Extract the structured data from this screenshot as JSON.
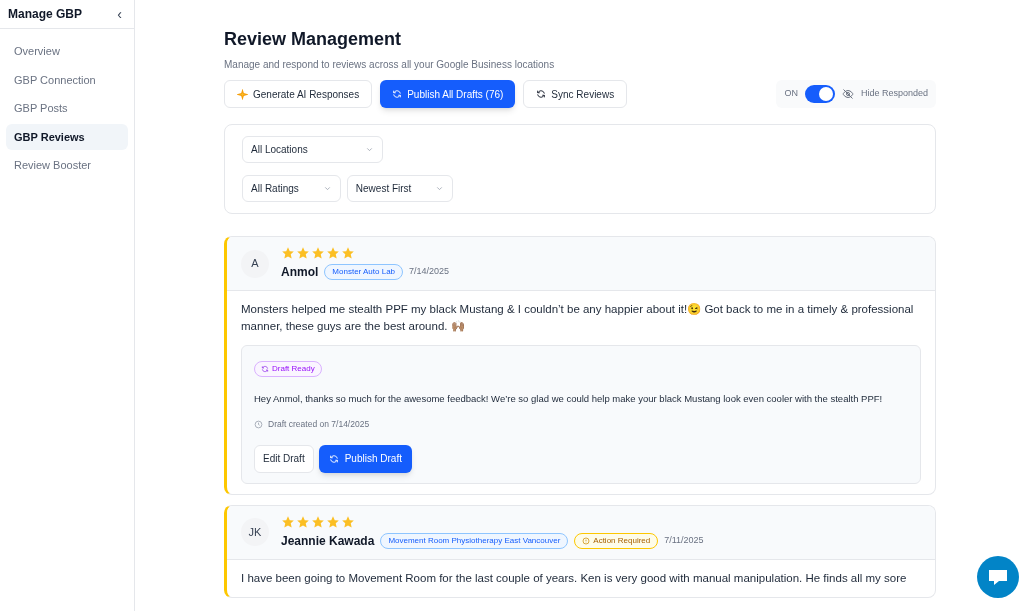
{
  "sidebar": {
    "title": "Manage GBP",
    "collapse_glyph": "‹",
    "items": [
      {
        "label": "Overview",
        "selected": false
      },
      {
        "label": "GBP Connection",
        "selected": false
      },
      {
        "label": "GBP Posts",
        "selected": false
      },
      {
        "label": "GBP Reviews",
        "selected": true
      },
      {
        "label": "Review Booster",
        "selected": false
      }
    ]
  },
  "header": {
    "title": "Review Management",
    "subtitle": "Manage and respond to reviews across all your Google Business locations"
  },
  "actions": [
    {
      "label": "Generate AI Responses",
      "kind": "sparkle"
    },
    {
      "label": "Publish All Drafts (76)",
      "kind": "primary"
    },
    {
      "label": "Sync Reviews",
      "kind": "sync"
    }
  ],
  "hide_toggle": {
    "state_label": "ON",
    "on": true,
    "label": "Hide Responded"
  },
  "filter_rows": [
    [
      "All Locations"
    ],
    [
      "All Ratings",
      "Newest First"
    ]
  ],
  "reviews": [
    {
      "initials": "A",
      "stars": 5,
      "name": "Anmol",
      "location": "Monster Auto Lab",
      "date": "7/14/2025",
      "text": "Monsters helped me stealth PPF my black Mustang & I couldn’t be any happier about it!😉 Got back to me in a timely & professional manner, these guys are the best around. 🙌🏽",
      "draft": {
        "badge": "Draft Ready",
        "text": "Hey Anmol, thanks so much for the awesome feedback! We’re so glad we could help make your black Mustang look even cooler with the stealth PPF!",
        "created": "Draft created on 7/14/2025",
        "edit": "Edit Draft",
        "publish": "Publish Draft"
      }
    },
    {
      "initials": "JK",
      "stars": 5,
      "name": "Jeannie Kawada",
      "location": "Movement Room Physiotherapy East Vancouver",
      "status": "Action Required",
      "date": "7/11/2025",
      "text": "I have been going to Movement Room for the last couple of years. Ken is very good with manual manipulation. He finds all my sore"
    }
  ]
}
